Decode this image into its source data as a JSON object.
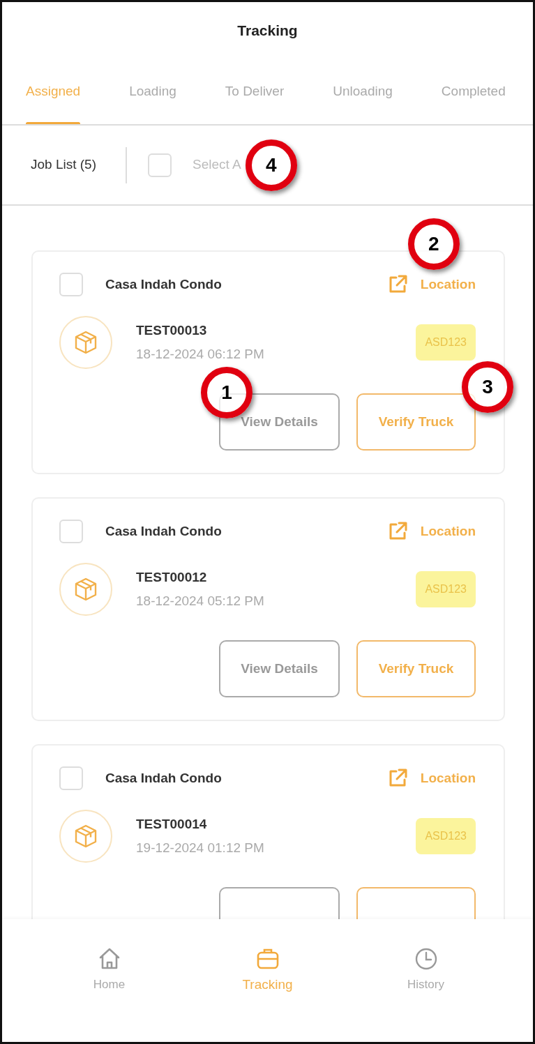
{
  "header": {
    "title": "Tracking"
  },
  "tabs": [
    {
      "label": "Assigned",
      "selected": true
    },
    {
      "label": "Loading",
      "selected": false
    },
    {
      "label": "To Deliver",
      "selected": false
    },
    {
      "label": "Unloading",
      "selected": false
    },
    {
      "label": "Completed",
      "selected": false
    }
  ],
  "toolbar": {
    "job_list": "Job List (5)",
    "select_all": {
      "label": "Select A",
      "checked": false,
      "marker": "4"
    }
  },
  "jobs": [
    {
      "checked": false,
      "site": "Casa Indah Condo",
      "location": "Location",
      "location_marker": "2",
      "job_no": "TEST00013",
      "datetime": "18-12-2024 06:12 PM",
      "truck": "ASD123",
      "view_label": "View Details",
      "view_marker": "1",
      "verify_label": "Verify Truck",
      "verify_marker": "3"
    },
    {
      "checked": false,
      "site": "Casa Indah Condo",
      "location": "Location",
      "job_no": "TEST00012",
      "datetime": "18-12-2024 05:12 PM",
      "truck": "ASD123",
      "view_label": "View Details",
      "verify_label": "Verify Truck"
    },
    {
      "checked": false,
      "site": "Casa Indah Condo",
      "location": "Location",
      "job_no": "TEST00014",
      "datetime": "19-12-2024 01:12 PM",
      "truck": "ASD123"
    }
  ],
  "bottom_nav": [
    {
      "label": "Home",
      "selected": false
    },
    {
      "label": "Tracking",
      "selected": true
    },
    {
      "label": "History",
      "selected": false
    }
  ]
}
